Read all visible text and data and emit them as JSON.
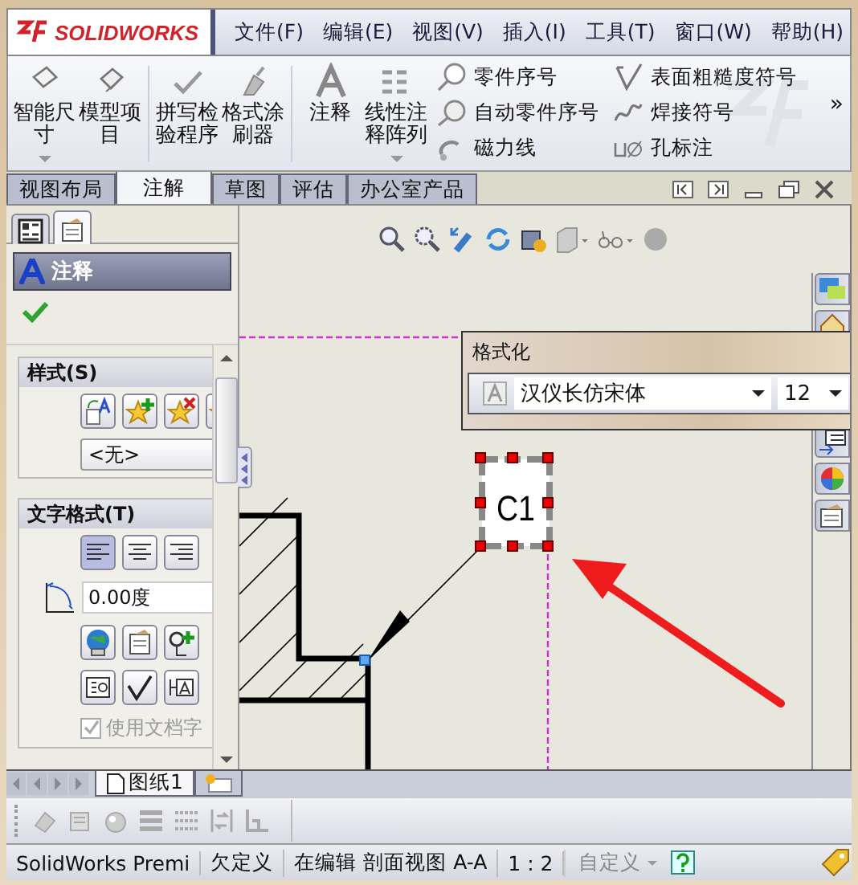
{
  "logo": "SOLIDWORKS",
  "menu": [
    "文件(F)",
    "编辑(E)",
    "视图(V)",
    "插入(I)",
    "工具(T)",
    "窗口(W)",
    "帮助(H)"
  ],
  "ribbon": {
    "large_buttons": [
      {
        "label": "智能尺寸",
        "kind": "dimension",
        "dropdown": true
      },
      {
        "label": "模型项目",
        "kind": "model",
        "dropdown": false
      },
      {
        "label": "拼写检验程序",
        "kind": "spell",
        "dropdown": false
      },
      {
        "label": "格式涂刷器",
        "kind": "painter",
        "dropdown": false
      },
      {
        "label": "注释",
        "kind": "note",
        "dropdown": false
      },
      {
        "label": "线性注释阵列",
        "kind": "pattern",
        "dropdown": true
      }
    ],
    "small_columns": [
      [
        {
          "label": "零件序号",
          "kind": "balloon"
        },
        {
          "label": "自动零件序号",
          "kind": "autoballoon"
        },
        {
          "label": "磁力线",
          "kind": "magnet"
        }
      ],
      [
        {
          "label": "表面粗糙度符号",
          "kind": "surface"
        },
        {
          "label": "焊接符号",
          "kind": "weld"
        },
        {
          "label": "孔标注",
          "kind": "hole"
        }
      ]
    ],
    "more": "»"
  },
  "tabs": [
    {
      "label": "视图布局",
      "selected": false
    },
    {
      "label": "注解",
      "selected": true
    },
    {
      "label": "草图",
      "selected": false
    },
    {
      "label": "评估",
      "selected": false
    },
    {
      "label": "办公室产品",
      "selected": false
    }
  ],
  "property_manager": {
    "panel_tabs": [
      {
        "selected": false
      },
      {
        "selected": true
      }
    ],
    "title": "注释",
    "style_section": {
      "title": "样式(S)",
      "style": "<无>"
    },
    "text_format_section": {
      "title": "文字格式(T)",
      "alignments": [
        {
          "selected": true
        },
        {
          "selected": false
        },
        {
          "selected": false
        }
      ],
      "angle": "0.00度",
      "use_document_font": {
        "label": "使用文档字",
        "checked": true,
        "disabled": true
      }
    }
  },
  "format_popup": {
    "title": "格式化",
    "font": "汉仪长仿宋体",
    "size": "12"
  },
  "note": {
    "text": "C1"
  },
  "sheet_tabs": [
    {
      "label": "图纸1",
      "selected": true
    }
  ],
  "status_bar": {
    "product": "SolidWorks Premi",
    "state": "欠定义",
    "editing": "在编辑 剖面视图 A-A",
    "scale": "1 : 2",
    "units": {
      "label": "自定义",
      "disabled": true
    }
  }
}
